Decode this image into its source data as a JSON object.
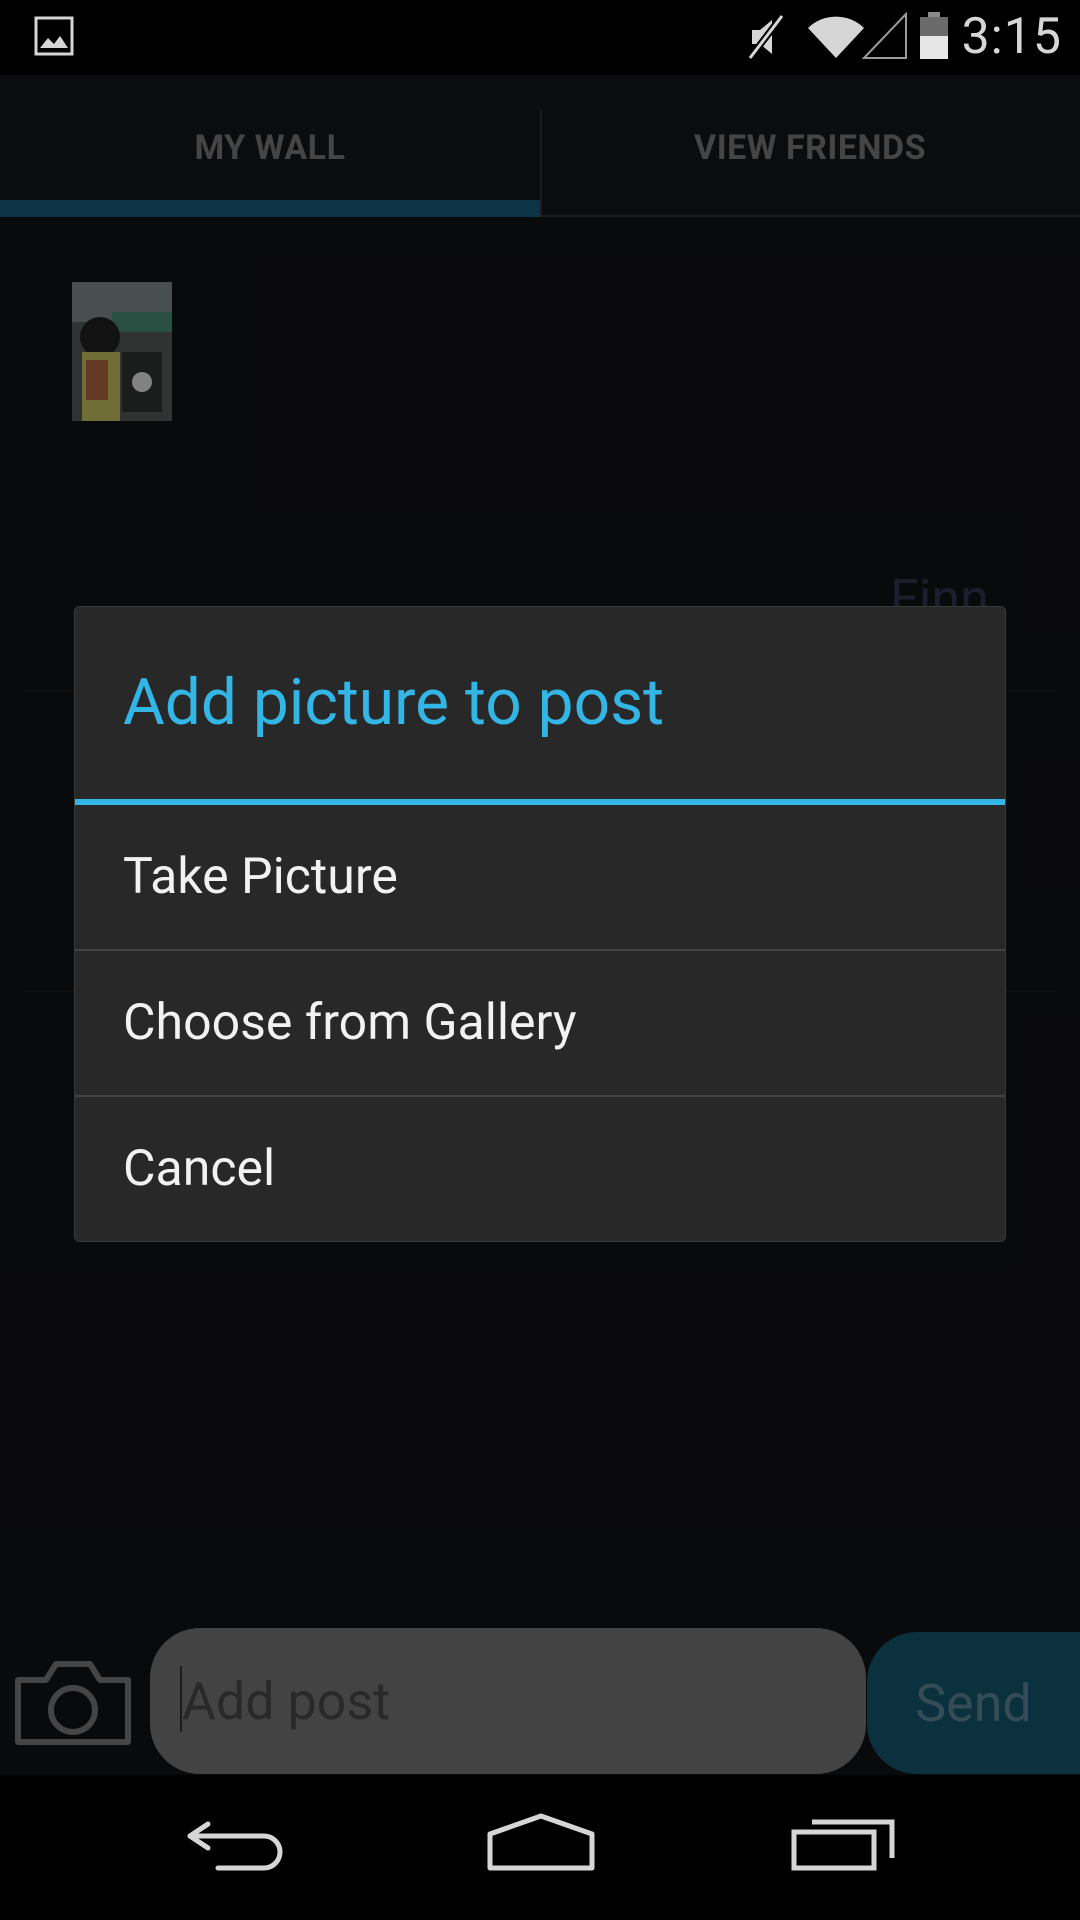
{
  "status_bar": {
    "time": "3:15",
    "icons": [
      "image-notification-icon",
      "muted-icon",
      "wifi-icon",
      "signal-icon",
      "battery-icon"
    ]
  },
  "tabs": [
    {
      "label": "MY WALL",
      "selected": true
    },
    {
      "label": "VIEW FRIENDS",
      "selected": false
    }
  ],
  "wall": {
    "partial_text": "Finn"
  },
  "composer": {
    "placeholder": "Add post",
    "send_label": "Send"
  },
  "dialog": {
    "title": "Add picture to post",
    "items": [
      {
        "label": "Take Picture"
      },
      {
        "label": "Choose from Gallery"
      },
      {
        "label": "Cancel"
      }
    ]
  },
  "colors": {
    "accent": "#33b5e5",
    "tab_indicator": "#13506c",
    "send_button": "#124a60"
  }
}
